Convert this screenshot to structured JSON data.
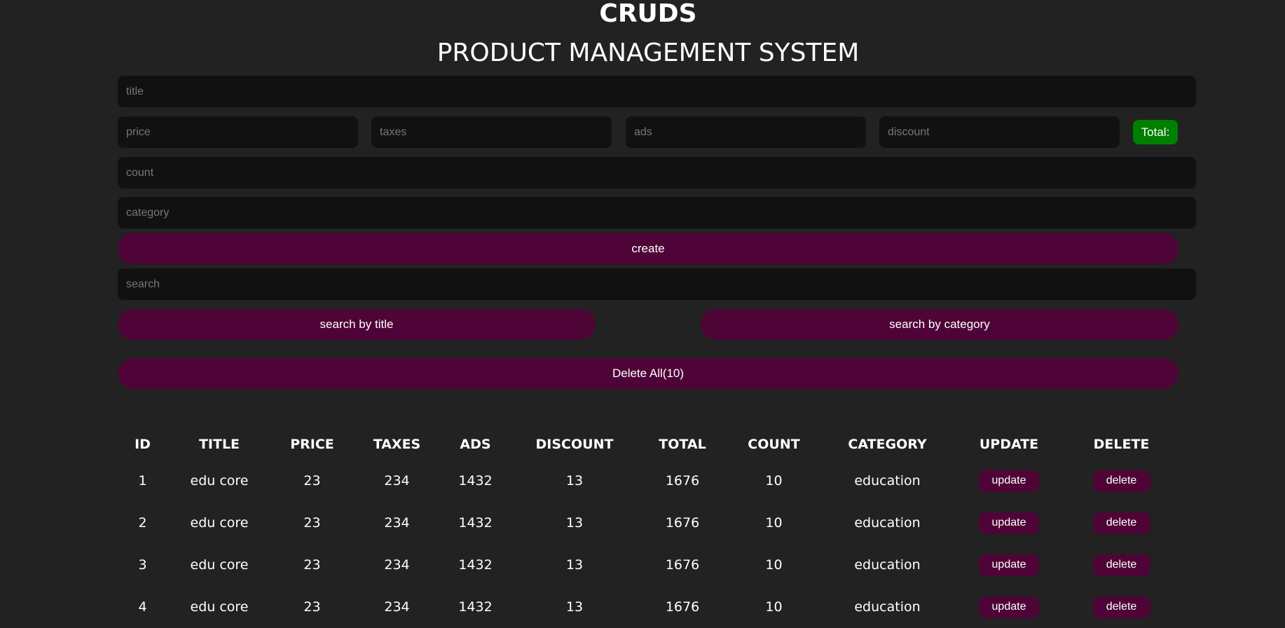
{
  "header": {
    "title": "CRUDS",
    "subtitle": "PRODUCT MANAGEMENT SYSTEM"
  },
  "form": {
    "title_placeholder": "title",
    "price_placeholder": "price",
    "taxes_placeholder": "taxes",
    "ads_placeholder": "ads",
    "discount_placeholder": "discount",
    "total_label": "Total:",
    "count_placeholder": "count",
    "category_placeholder": "category",
    "create_label": "create"
  },
  "search": {
    "placeholder": "search",
    "by_title_label": "search by title",
    "by_category_label": "search by category"
  },
  "delete_all_label": "Delete All(10)",
  "colors": {
    "background": "#222222",
    "input_bg": "#111111",
    "button_bg": "#4f0437",
    "total_bg": "#008000"
  },
  "table": {
    "headers": [
      "ID",
      "TITLE",
      "PRICE",
      "TAXES",
      "ADS",
      "DISCOUNT",
      "TOTAL",
      "COUNT",
      "CATEGORY",
      "UPDATE",
      "DELETE"
    ],
    "update_label": "update",
    "delete_label": "delete",
    "rows": [
      {
        "id": "1",
        "title": "edu core",
        "price": "23",
        "taxes": "234",
        "ads": "1432",
        "discount": "13",
        "total": "1676",
        "count": "10",
        "category": "education"
      },
      {
        "id": "2",
        "title": "edu core",
        "price": "23",
        "taxes": "234",
        "ads": "1432",
        "discount": "13",
        "total": "1676",
        "count": "10",
        "category": "education"
      },
      {
        "id": "3",
        "title": "edu core",
        "price": "23",
        "taxes": "234",
        "ads": "1432",
        "discount": "13",
        "total": "1676",
        "count": "10",
        "category": "education"
      },
      {
        "id": "4",
        "title": "edu core",
        "price": "23",
        "taxes": "234",
        "ads": "1432",
        "discount": "13",
        "total": "1676",
        "count": "10",
        "category": "education"
      }
    ]
  }
}
